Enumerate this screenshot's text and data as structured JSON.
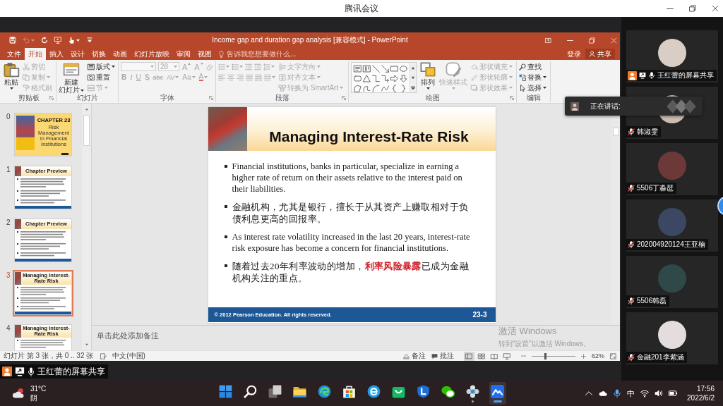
{
  "meeting_window": {
    "title": "腾讯会议"
  },
  "powerpoint": {
    "title": "Income gap and duration gap analysis [兼容模式] - PowerPoint",
    "quick_access": [
      {
        "kind": "save",
        "dropdown": false,
        "disabled": false
      },
      {
        "kind": "undo",
        "dropdown": true,
        "disabled": true
      },
      {
        "kind": "redo",
        "dropdown": false,
        "disabled": false
      },
      {
        "kind": "present",
        "dropdown": false,
        "disabled": false
      },
      {
        "kind": "touch",
        "dropdown": true,
        "disabled": false
      },
      {
        "kind": "customize",
        "dropdown": false,
        "disabled": false
      }
    ],
    "tabs": [
      {
        "label": "文件",
        "selected": false
      },
      {
        "label": "开始",
        "selected": true
      },
      {
        "label": "插入",
        "selected": false
      },
      {
        "label": "设计",
        "selected": false
      },
      {
        "label": "切换",
        "selected": false
      },
      {
        "label": "动画",
        "selected": false
      },
      {
        "label": "幻灯片放映",
        "selected": false
      },
      {
        "label": "审阅",
        "selected": false
      },
      {
        "label": "视图",
        "selected": false
      }
    ],
    "tell_me": "告诉我您想要做什么...",
    "sign_in": "登录",
    "share": "共享",
    "ribbon": [
      {
        "label": "剪贴板",
        "launcher": true,
        "columns": [
          [
            [
              {
                "kind": "paste",
                "label": "粘贴",
                "dropdown": true,
                "disabled": false
              }
            ]
          ],
          [
            [
              {
                "kind": "cut",
                "label": "剪切",
                "dropdown": false,
                "disabled": true
              }
            ],
            [
              {
                "kind": "copy",
                "label": "复制",
                "dropdown": true,
                "disabled": true
              }
            ],
            [
              {
                "kind": "format_painter",
                "label": "格式刷",
                "dropdown": false,
                "disabled": true
              }
            ]
          ]
        ]
      },
      {
        "label": "幻灯片",
        "launcher": false,
        "columns": [
          [
            [
              {
                "kind": "new_slide",
                "label": [
                  "新建",
                  "幻灯片"
                ],
                "dropdown": true,
                "disabled": false
              }
            ]
          ],
          [
            [
              {
                "kind": "layout",
                "label": "版式",
                "dropdown": true,
                "disabled": false
              }
            ],
            [
              {
                "kind": "reset",
                "label": "重置",
                "dropdown": false,
                "disabled": false
              }
            ],
            [
              {
                "kind": "section",
                "label": "节",
                "dropdown": true,
                "disabled": true
              }
            ]
          ]
        ]
      },
      {
        "label": "字体",
        "launcher": true,
        "columns": [
          [
            [
              {
                "kind": "font_name",
                "dropdown": true,
                "disabled": true
              },
              {
                "kind": "font_size",
                "value": "28",
                "dropdown": true,
                "disabled": true
              },
              {
                "kind": "grow",
                "glyph": "A",
                "dropdown": false,
                "disabled": true
              },
              {
                "kind": "shrink",
                "glyph": "A",
                "dropdown": false,
                "disabled": true
              },
              {
                "kind": "clear_format",
                "dropdown": false,
                "disabled": true
              }
            ],
            [
              {
                "kind": "bold",
                "glyph": "B",
                "dropdown": false,
                "disabled": true
              },
              {
                "kind": "italic",
                "glyph": "I",
                "dropdown": false,
                "disabled": true
              },
              {
                "kind": "underline",
                "glyph": "U",
                "dropdown": false,
                "disabled": true
              },
              {
                "kind": "shadow",
                "glyph": "S",
                "dropdown": false,
                "disabled": true
              },
              {
                "kind": "strikethrough",
                "glyph": "abc",
                "dropdown": false,
                "disabled": true
              },
              {
                "kind": "spacing",
                "glyph": "AV",
                "dropdown": true,
                "disabled": true
              },
              {
                "kind": "change_case",
                "glyph": "Aa",
                "dropdown": true,
                "disabled": true
              },
              {
                "kind": "font_color",
                "glyph": "A",
                "dropdown": true,
                "disabled": true
              }
            ]
          ]
        ]
      },
      {
        "label": "段落",
        "launcher": true,
        "columns": [
          [
            [
              {
                "kind": "bullets",
                "dropdown": true,
                "disabled": true
              },
              {
                "kind": "numbering",
                "dropdown": true,
                "disabled": true
              },
              {
                "kind": "outdent",
                "dropdown": false,
                "disabled": true
              },
              {
                "kind": "indent",
                "dropdown": false,
                "disabled": true
              },
              {
                "kind": "line_spacing",
                "dropdown": true,
                "disabled": true
              }
            ],
            [
              {
                "kind": "align_left",
                "dropdown": false,
                "disabled": true
              },
              {
                "kind": "align_center",
                "dropdown": false,
                "disabled": true
              },
              {
                "kind": "align_right",
                "dropdown": false,
                "disabled": true
              },
              {
                "kind": "justify",
                "dropdown": false,
                "disabled": true
              },
              {
                "kind": "distribute",
                "dropdown": false,
                "disabled": true
              },
              {
                "kind": "columns",
                "dropdown": true,
                "disabled": true
              }
            ]
          ],
          [
            [
              {
                "kind": "text_direction",
                "label": "文字方向",
                "dropdown": true,
                "disabled": true
              }
            ],
            [
              {
                "kind": "align_text",
                "label": "对齐文本",
                "dropdown": true,
                "disabled": true
              }
            ],
            [
              {
                "kind": "smartart",
                "label": "转换为 SmartArt",
                "dropdown": true,
                "disabled": true
              }
            ]
          ]
        ]
      },
      {
        "label": "绘图",
        "launcher": true,
        "columns": [
          [
            [
              {
                "kind": "shape_gallery",
                "disabled": false
              }
            ]
          ],
          [
            [
              {
                "kind": "arrange",
                "label": "排列",
                "dropdown": true,
                "disabled": false
              }
            ]
          ],
          [
            [
              {
                "kind": "quick_styles",
                "label": "快速样式",
                "dropdown": true,
                "disabled": true
              }
            ]
          ],
          [
            [
              {
                "kind": "shape_fill",
                "label": "形状填充",
                "dropdown": true,
                "disabled": true
              }
            ],
            [
              {
                "kind": "shape_outline",
                "label": "形状轮廓",
                "dropdown": true,
                "disabled": true
              }
            ],
            [
              {
                "kind": "shape_effects",
                "label": "形状效果",
                "dropdown": true,
                "disabled": true
              }
            ]
          ]
        ]
      },
      {
        "label": "编辑",
        "launcher": false,
        "columns": [
          [
            [
              {
                "kind": "find",
                "label": "查找",
                "dropdown": false,
                "disabled": false
              }
            ],
            [
              {
                "kind": "replace",
                "label": "替换",
                "dropdown": true,
                "disabled": false
              }
            ],
            [
              {
                "kind": "select",
                "label": "选择",
                "dropdown": true,
                "disabled": false
              }
            ]
          ]
        ]
      }
    ],
    "slides": [
      {
        "number": "0",
        "kind": "cover",
        "selected": false,
        "title": "CHAPTER 23",
        "subtitle": "Risk Management in Financial Institutions"
      },
      {
        "number": "1",
        "kind": "content",
        "selected": false,
        "title": "Chapter Preview"
      },
      {
        "number": "2",
        "kind": "content",
        "selected": false,
        "title": "Chapter Preview"
      },
      {
        "number": "3",
        "kind": "content",
        "selected": true,
        "title": "Managing Interest-Rate Risk"
      },
      {
        "number": "4",
        "kind": "content",
        "selected": false,
        "title": "Managing Interest-Rate Risk"
      }
    ],
    "current_slide": {
      "title": "Managing Interest-Rate Risk",
      "bullets": [
        {
          "kind": "english",
          "text": "Financial institutions, banks in particular, specialize in earning a higher rate of return on their assets relative to the interest paid on their liabilities."
        },
        {
          "kind": "chinese",
          "text": "金融机构，尤其是银行，擅长于从其资产上赚取相对于负债利息更高的回报率。"
        },
        {
          "kind": "english",
          "text": "As interest rate volatility increased in the last 20 years, interest-rate risk exposure has become a concern for financial institutions."
        },
        {
          "kind": "chinese",
          "text": "随着过去20年利率波动的增加，**利率风险暴露**已成为金融机构关注的重点。"
        }
      ],
      "footer": "© 2012 Pearson Education. All rights reserved.",
      "page_number": "23-3"
    },
    "notes": {
      "placeholder": "单击此处添加备注"
    },
    "status_bar": {
      "slide_info": "幻灯片 第 3 张，共 0 .. 32 张",
      "language": "中文(中国)",
      "notes_label": "备注",
      "comments_label": "批注",
      "views": [
        {
          "kind": "normal",
          "selected": true
        },
        {
          "kind": "sorter",
          "selected": false
        },
        {
          "kind": "reading",
          "selected": false
        },
        {
          "kind": "slideshow",
          "selected": false
        }
      ],
      "zoom": {
        "level": 0.3,
        "reading": "62%"
      }
    }
  },
  "activation_notice": {
    "title": "激活 Windows",
    "detail": "转到“设置”以激活 Windows。"
  },
  "speaking_indicator": {
    "label": "正在讲话:"
  },
  "share_banner": {
    "label": "王红蕾的屏幕共享",
    "muted": false
  },
  "participants": [
    {
      "name": "王红蕾的屏幕共享",
      "presenter": true,
      "muted": false
    },
    {
      "name": "韩淑雯",
      "presenter": false,
      "muted": true
    },
    {
      "name": "5506丁淼琶",
      "presenter": false,
      "muted": true
    },
    {
      "name": "202004920124王亚楠",
      "presenter": false,
      "muted": true
    },
    {
      "name": "5506韩磊",
      "presenter": false,
      "muted": true
    },
    {
      "name": "金融201李紫涵",
      "presenter": false,
      "muted": true
    }
  ],
  "taskbar": {
    "weather": {
      "temperature": "31°C",
      "condition": "阴"
    },
    "apps": [
      {
        "kind": "start",
        "running": false,
        "active": false
      },
      {
        "kind": "search",
        "running": false,
        "active": false
      },
      {
        "kind": "task_view",
        "running": false,
        "active": false
      },
      {
        "kind": "folder",
        "running": false,
        "active": false
      },
      {
        "kind": "swirl",
        "running": false,
        "active": false
      },
      {
        "kind": "store",
        "running": false,
        "active": false
      },
      {
        "kind": "e_circle",
        "running": false,
        "active": false
      },
      {
        "kind": "bag",
        "running": false,
        "active": false
      },
      {
        "kind": "shield",
        "running": false,
        "active": false
      },
      {
        "kind": "chat",
        "running": false,
        "active": false
      },
      {
        "kind": "flower",
        "running": true,
        "active": false
      },
      {
        "kind": "meeting",
        "running": true,
        "active": true
      }
    ],
    "input_method": "中",
    "time": "17:56",
    "date": "2022/6/2"
  }
}
